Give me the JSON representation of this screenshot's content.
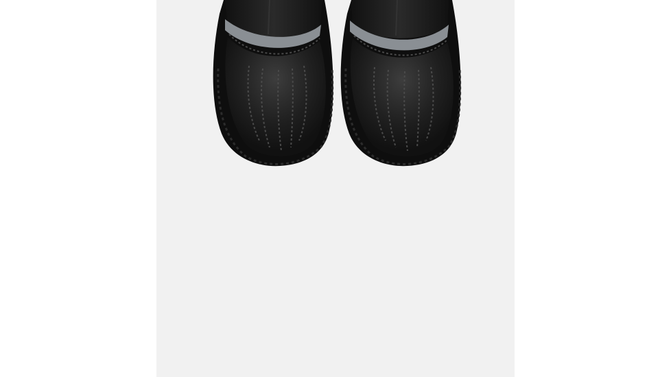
{
  "image": {
    "subject": "boots-top-view",
    "colors": {
      "page_background": "#ffffff",
      "panel_background": "#f1f1f1",
      "boot_leather": "#1d1d1d",
      "boot_highlight": "#3a3a3a",
      "reflective_band": "#8a8f94",
      "sole": "#121212"
    }
  }
}
